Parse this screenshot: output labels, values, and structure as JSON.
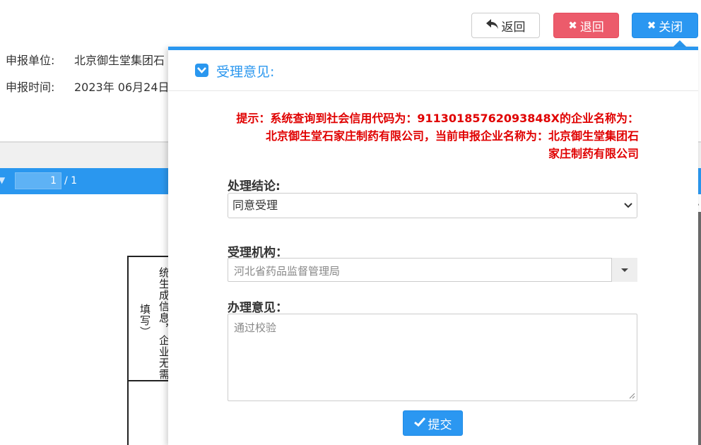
{
  "toolbar": {
    "back_label": "返回",
    "return_label": "退回",
    "close_label": "关闭"
  },
  "info": {
    "unit_label": "申报单位:",
    "unit_value": "北京御生堂集团石",
    "time_label": "申报时间:",
    "time_value": "2023年 06月24日"
  },
  "pdf": {
    "current_page": "1",
    "total_pages": "/ 1"
  },
  "document": {
    "text_a": "统生成信息，企业无需",
    "text_b": "填写）"
  },
  "dialog": {
    "title": "受理意见:",
    "warning_line1": "提示：系统查询到社会信用代码为：91130185762093848X的企业名称为：",
    "warning_line2": "北京御生堂石家庄制药有限公司，当前申报企业名称为：北京御生堂集团石",
    "warning_line3": "家庄制药有限公司",
    "conclusion_label": "处理结论:",
    "conclusion_value": "同意受理",
    "org_label": "受理机构：",
    "org_placeholder": "河北省药品监督管理局",
    "opinion_label": "办理意见：",
    "opinion_placeholder": "通过校验",
    "submit_label": "提交"
  },
  "colors": {
    "primary": "#2a97ef",
    "danger": "#ec5b6b",
    "warning_text": "#e00000"
  }
}
